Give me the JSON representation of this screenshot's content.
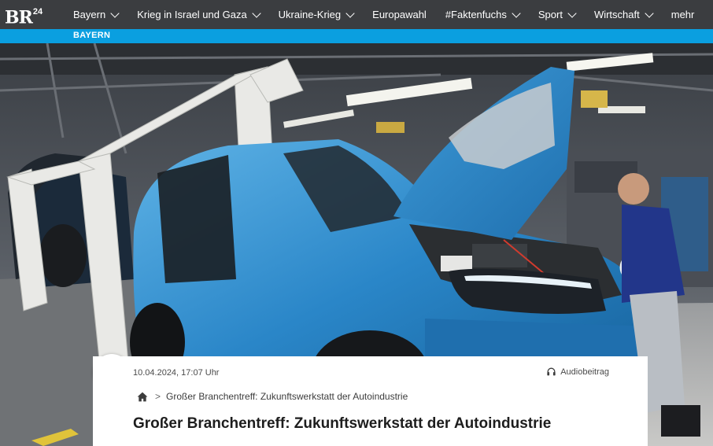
{
  "header": {
    "logo_text": "BR",
    "logo_sup": "24",
    "nav_items": [
      {
        "label": "Bayern",
        "has_dropdown": true
      },
      {
        "label": "Krieg in Israel und Gaza",
        "has_dropdown": true
      },
      {
        "label": "Ukraine-Krieg",
        "has_dropdown": true
      },
      {
        "label": "Europawahl",
        "has_dropdown": false
      },
      {
        "label": "#Faktenfuchs",
        "has_dropdown": true
      },
      {
        "label": "Sport",
        "has_dropdown": true
      },
      {
        "label": "Wirtschaft",
        "has_dropdown": true
      },
      {
        "label": "mehr",
        "has_dropdown": false
      }
    ],
    "section_label": "BAYERN",
    "colors": {
      "nav_bg": "#3b3d40",
      "section_bg": "#0a9fe0"
    }
  },
  "hero": {
    "icons": [
      "play-icon"
    ]
  },
  "article": {
    "date": "10.04.2024, 17:07 Uhr",
    "audio_label": "Audiobeitrag",
    "breadcrumb_separator": ">",
    "breadcrumb_current": "Großer Branchentreff: Zukunftswerkstatt der Autoindustrie",
    "title": "Großer Branchentreff: Zukunftswerkstatt der Autoindustrie",
    "icons": [
      "headphones-icon",
      "home-icon"
    ]
  }
}
